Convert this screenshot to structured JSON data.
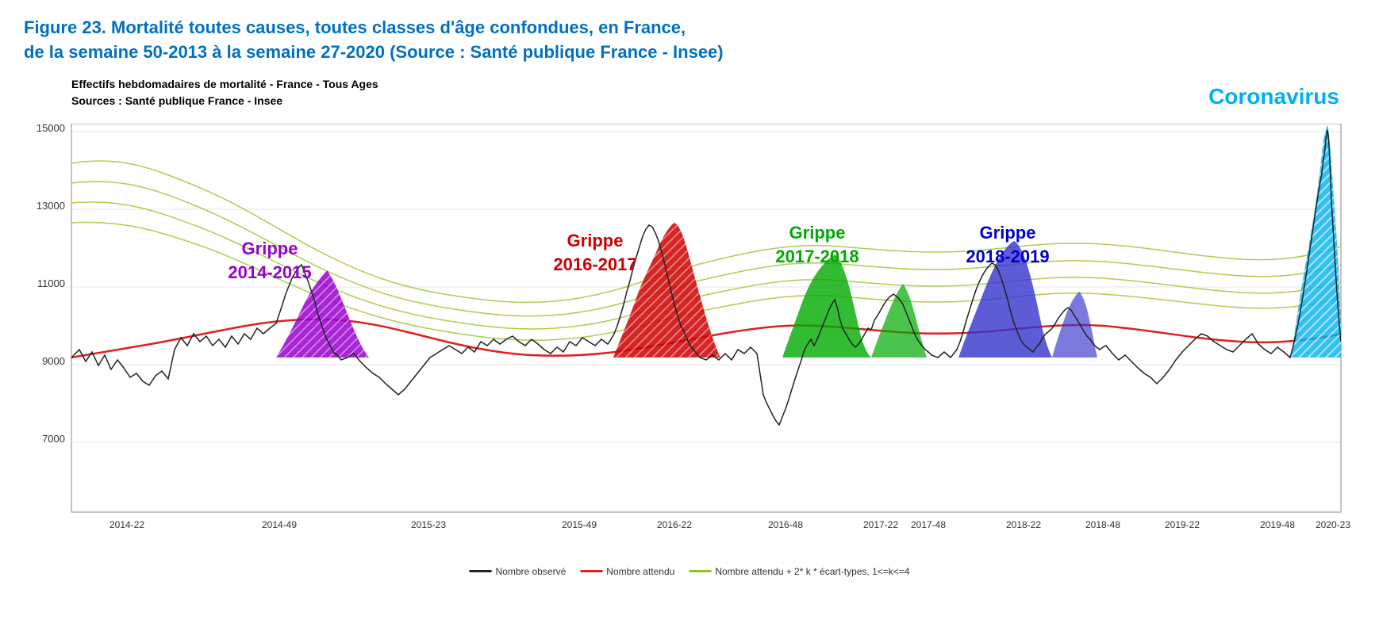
{
  "title": {
    "line1": "Figure 23.  Mortalité toutes causes, toutes classes d'âge confondues, en France,",
    "line2": "de la semaine 50-2013 à la semaine 27-2020 (Source : Santé publique France - Insee)"
  },
  "chart": {
    "header_line1": "Effectifs hebdomadaires de mortalité  - France - Tous Ages",
    "header_line2": "Sources : Santé publique France - Insee",
    "coronavirus_label": "Coronavirus",
    "y_axis": {
      "max": 15000,
      "labels": [
        "15000",
        "13000",
        "11000",
        "9000",
        "7000"
      ]
    },
    "x_axis": {
      "labels": [
        "2014-22",
        "2014-49",
        "2015-23",
        "2015-49",
        "2016-22",
        "2016-48",
        "2017-22",
        "2017-48",
        "2018-22",
        "2018-48",
        "2019-22",
        "2019-48",
        "2020-23"
      ]
    },
    "grippe_labels": [
      {
        "text_line1": "Grippe",
        "text_line2": "2014-2015",
        "color": "#9900cc"
      },
      {
        "text_line1": "Grippe",
        "text_line2": "2016-2017",
        "color": "#cc0000"
      },
      {
        "text_line1": "Grippe",
        "text_line2": "2017-2018",
        "color": "#00aa00"
      },
      {
        "text_line1": "Grippe",
        "text_line2": "2018-2019",
        "color": "#0000cc"
      }
    ]
  },
  "legend": {
    "observed": "Nombre observé",
    "expected": "Nombre attendu",
    "expected_k": "Nombre attendu + 2* k * écart-types, 1<=k<=4"
  }
}
